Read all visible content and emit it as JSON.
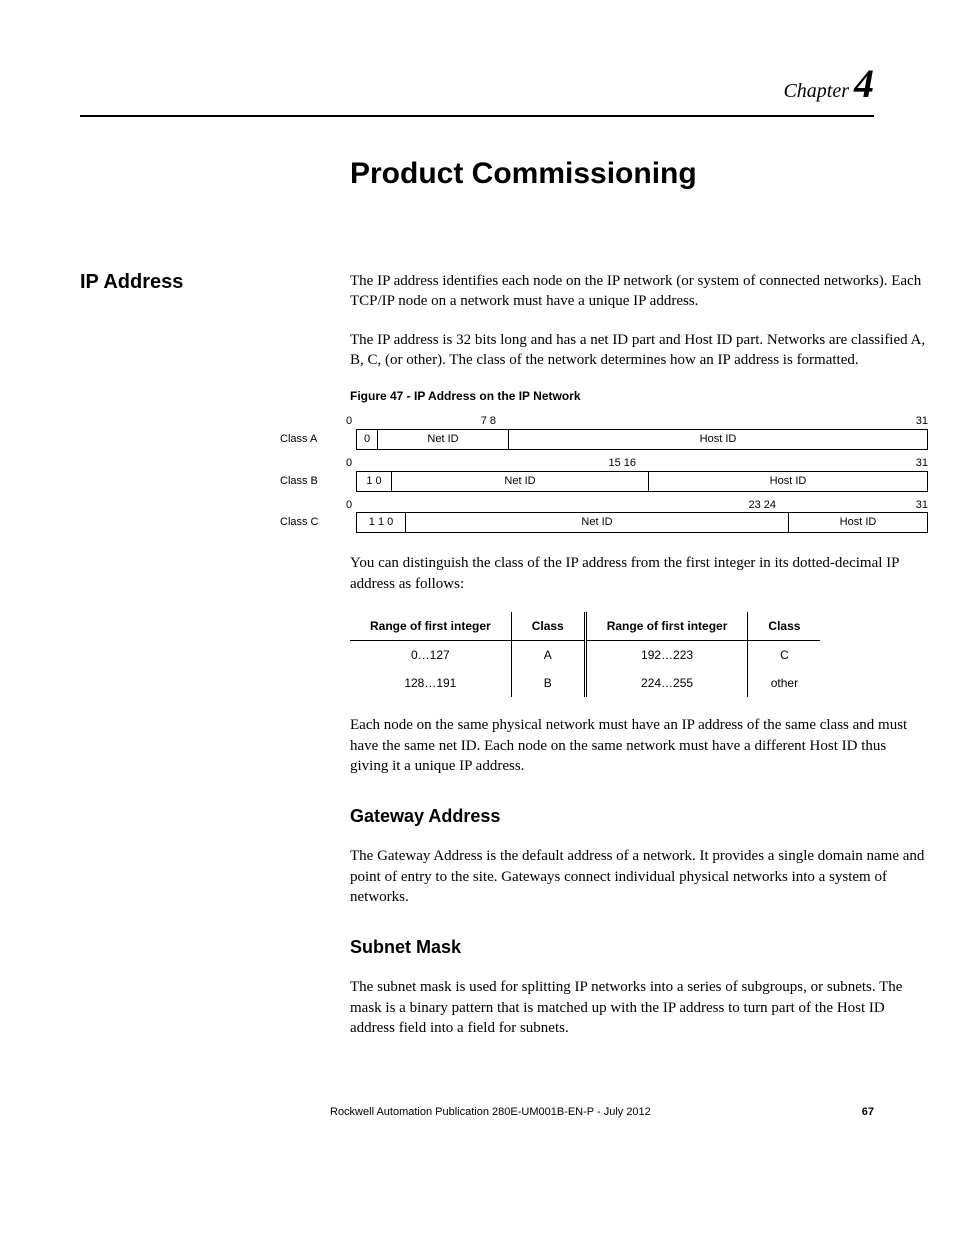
{
  "chapter": {
    "label": "Chapter",
    "number": "4"
  },
  "title": "Product Commissioning",
  "section": {
    "heading": "IP Address"
  },
  "p1": "The IP address identifies each node on the IP network (or system of connected networks). Each TCP/IP node on a network must have a unique IP address.",
  "p2": "The IP address is 32 bits long and has a net ID part and Host ID part. Networks are classified A, B, C, (or other). The class of the network determines how an IP address is formatted.",
  "figcap": "Figure 47 - IP Address on the IP Network",
  "diagram": {
    "a": {
      "label": "Class A",
      "b0": "0",
      "b7": "7 8",
      "b31": "31",
      "p0": "0",
      "net": "Net ID",
      "host": "Host ID"
    },
    "b": {
      "label": "Class B",
      "b0": "0",
      "b15": "15 16",
      "b31": "31",
      "p0": "1 0",
      "net": "Net ID",
      "host": "Host ID"
    },
    "c": {
      "label": "Class C",
      "b0": "0",
      "b23": "23 24",
      "b31": "31",
      "p0": "1 1 0",
      "net": "Net ID",
      "host": "Host ID"
    }
  },
  "p3": "You can distinguish the class of the IP address from the first integer in its dotted-decimal IP address as follows:",
  "table": {
    "h1": "Range of first integer",
    "h2": "Class",
    "h3": "Range of first integer",
    "h4": "Class",
    "r1c1": "0…127",
    "r1c2": "A",
    "r1c3": "192…223",
    "r1c4": "C",
    "r2c1": "128…191",
    "r2c2": "B",
    "r2c3": "224…255",
    "r2c4": "other"
  },
  "p4": "Each node on the same physical network must have an IP address of the same class and must have the same net ID. Each node on the same network must have a different Host ID thus giving it a unique IP address.",
  "gateway": {
    "heading": "Gateway Address",
    "p": "The Gateway Address is the default address of a network. It provides a single domain name and point of entry to the site. Gateways connect individual physical networks into a system of networks."
  },
  "subnet": {
    "heading": "Subnet Mask",
    "p": "The subnet mask is used for splitting IP networks into a series of subgroups, or subnets. The mask is a binary pattern that is matched up with the IP address to turn part of the Host ID address field into a field for subnets."
  },
  "footer": {
    "pub": "Rockwell Automation Publication 280E-UM001B-EN-P - July 2012",
    "page": "67"
  }
}
